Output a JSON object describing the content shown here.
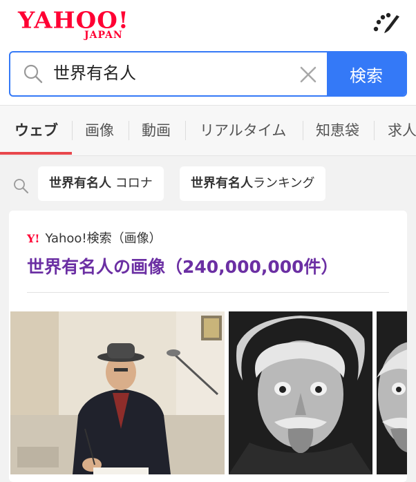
{
  "header": {
    "logo_text": "YAHOO!",
    "logo_sub": "JAPAN",
    "menu_icon": "tool-icon"
  },
  "search": {
    "value": "世界有名人",
    "button_label": "検索"
  },
  "tabs": [
    {
      "label": "ウェブ",
      "active": true
    },
    {
      "label": "画像"
    },
    {
      "label": "動画"
    },
    {
      "label": "リアルタイム"
    },
    {
      "label": "知恵袋"
    },
    {
      "label": "求人"
    }
  ],
  "suggestions": [
    {
      "bold": "世界有名人",
      "rest": " コロナ"
    },
    {
      "bold": "世界有名人",
      "rest": "ランキング"
    }
  ],
  "card": {
    "source_logo": "Y!",
    "source": "Yahoo!検索（画像）",
    "title": "世界有名人の画像（240,000,000件）"
  },
  "colors": {
    "brand_red": "#ff0033",
    "accent_blue": "#3479f7",
    "link_purple": "#6b2fa3",
    "tab_underline": "#e8474c"
  }
}
